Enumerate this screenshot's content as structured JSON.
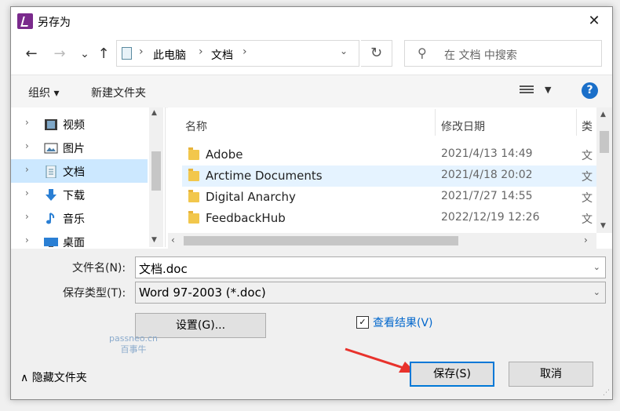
{
  "window": {
    "title": "另存为",
    "close_glyph": "✕"
  },
  "navigation": {
    "back_glyph": "←",
    "forward_glyph": "→",
    "recent_glyph": "⌄",
    "up_glyph": "↑",
    "breadcrumbs": [
      "此电脑",
      "文档"
    ],
    "refresh_glyph": "↻",
    "search_placeholder": "在 文档 中搜索"
  },
  "toolbar": {
    "organize_label": "组织 ▾",
    "new_folder_label": "新建文件夹",
    "help_glyph": "?"
  },
  "nav_pane": {
    "items": [
      {
        "label": "视频",
        "icon": "video-icon"
      },
      {
        "label": "图片",
        "icon": "picture-icon"
      },
      {
        "label": "文档",
        "icon": "document-icon",
        "selected": true
      },
      {
        "label": "下载",
        "icon": "download-icon"
      },
      {
        "label": "音乐",
        "icon": "music-icon"
      },
      {
        "label": "桌面",
        "icon": "desktop-icon"
      }
    ]
  },
  "file_list": {
    "columns": {
      "name": "名称",
      "modified": "修改日期",
      "type": "类"
    },
    "rows": [
      {
        "name": "Adobe",
        "modified": "2021/4/13 14:49",
        "type": "文"
      },
      {
        "name": "Arctime Documents",
        "modified": "2021/4/18 20:02",
        "type": "文",
        "selected": true
      },
      {
        "name": "Digital Anarchy",
        "modified": "2021/7/27 14:55",
        "type": "文"
      },
      {
        "name": "FeedbackHub",
        "modified": "2022/12/19 12:26",
        "type": "文"
      }
    ]
  },
  "form": {
    "filename_label": "文件名(N):",
    "filename_value": "文档.doc",
    "filetype_label": "保存类型(T):",
    "filetype_value": "Word 97-2003 (*.doc)",
    "settings_label": "设置(G)...",
    "view_results_label": "查看结果(V)",
    "view_results_checked": true
  },
  "watermark": {
    "line1": "passneo.cn",
    "line2": "百事牛"
  },
  "footer": {
    "hide_folders_label": "隐藏文件夹",
    "save_label": "保存(S)",
    "cancel_label": "取消"
  },
  "colors": {
    "accent": "#0078d7",
    "selection": "#cce8ff",
    "annotation_arrow": "#e8322c"
  }
}
